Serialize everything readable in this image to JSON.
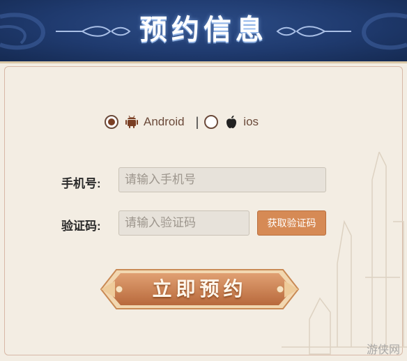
{
  "header": {
    "title": "预约信息"
  },
  "platform": {
    "options": [
      {
        "label": "Android",
        "checked": true,
        "icon": "android-icon"
      },
      {
        "label": "ios",
        "checked": false,
        "icon": "apple-icon"
      }
    ],
    "separator": "|"
  },
  "form": {
    "phone_label": "手机号:",
    "phone_placeholder": "请输入手机号",
    "code_label": "验证码:",
    "code_placeholder": "请输入验证码",
    "get_code_label": "获取验证码"
  },
  "submit": {
    "label": "立即预约"
  },
  "watermark": {
    "text": "游侠网"
  },
  "colors": {
    "header_bg": "#1f3a6e",
    "panel_bg": "#f3ede3",
    "accent": "#d68a55",
    "text_brown": "#6b4a3a"
  }
}
